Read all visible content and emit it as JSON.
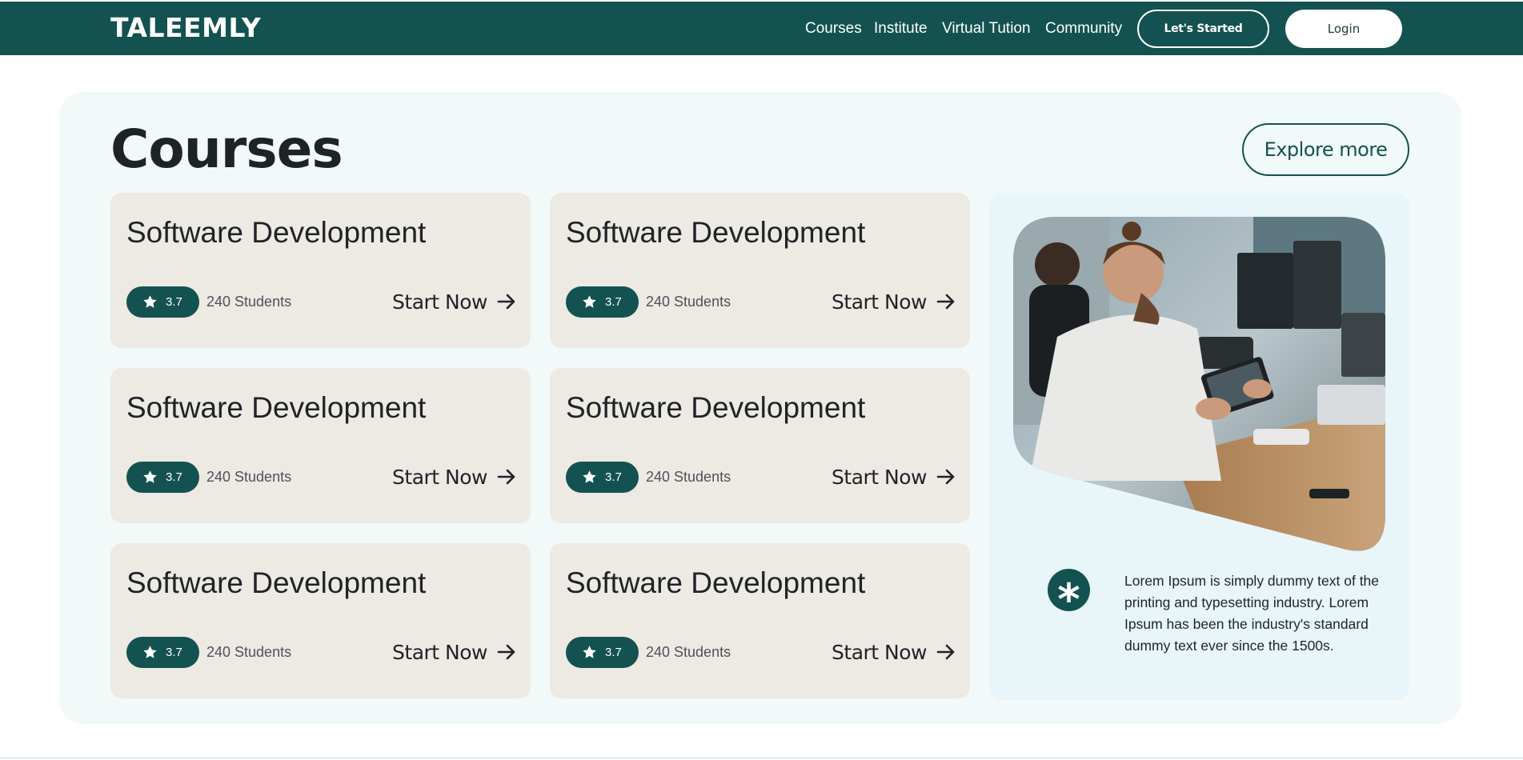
{
  "nav": {
    "logo": "TALEEMLY",
    "links": [
      "Courses",
      "Institute",
      "Virtual Tution",
      "Community"
    ],
    "started_label": "Let's Started",
    "login_label": "Login"
  },
  "main": {
    "heading": "Courses",
    "explore_label": "Explore more",
    "cards": [
      {
        "title": "Software Development",
        "rating": "3.7",
        "students": "240 Students",
        "cta": "Start Now"
      },
      {
        "title": "Software Development",
        "rating": "3.7",
        "students": "240 Students",
        "cta": "Start Now"
      },
      {
        "title": "Software Development",
        "rating": "3.7",
        "students": "240 Students",
        "cta": "Start Now"
      },
      {
        "title": "Software Development",
        "rating": "3.7",
        "students": "240 Students",
        "cta": "Start Now"
      },
      {
        "title": "Software Development",
        "rating": "3.7",
        "students": "240 Students",
        "cta": "Start Now"
      },
      {
        "title": "Software Development",
        "rating": "3.7",
        "students": "240 Students",
        "cta": "Start Now"
      }
    ]
  },
  "side": {
    "asterisk": "*",
    "text": "Lorem Ipsum is simply dummy text of the printing and typesetting industry. Lorem Ipsum has been the industry's standard dummy text ever since the 1500s."
  },
  "colors": {
    "brand": "#135250",
    "panel": "#f1faf8",
    "card": "#ede9e3",
    "side_card": "#e8f5f9"
  },
  "icons": [
    "star-icon",
    "arrow-right-icon",
    "asterisk-icon"
  ]
}
